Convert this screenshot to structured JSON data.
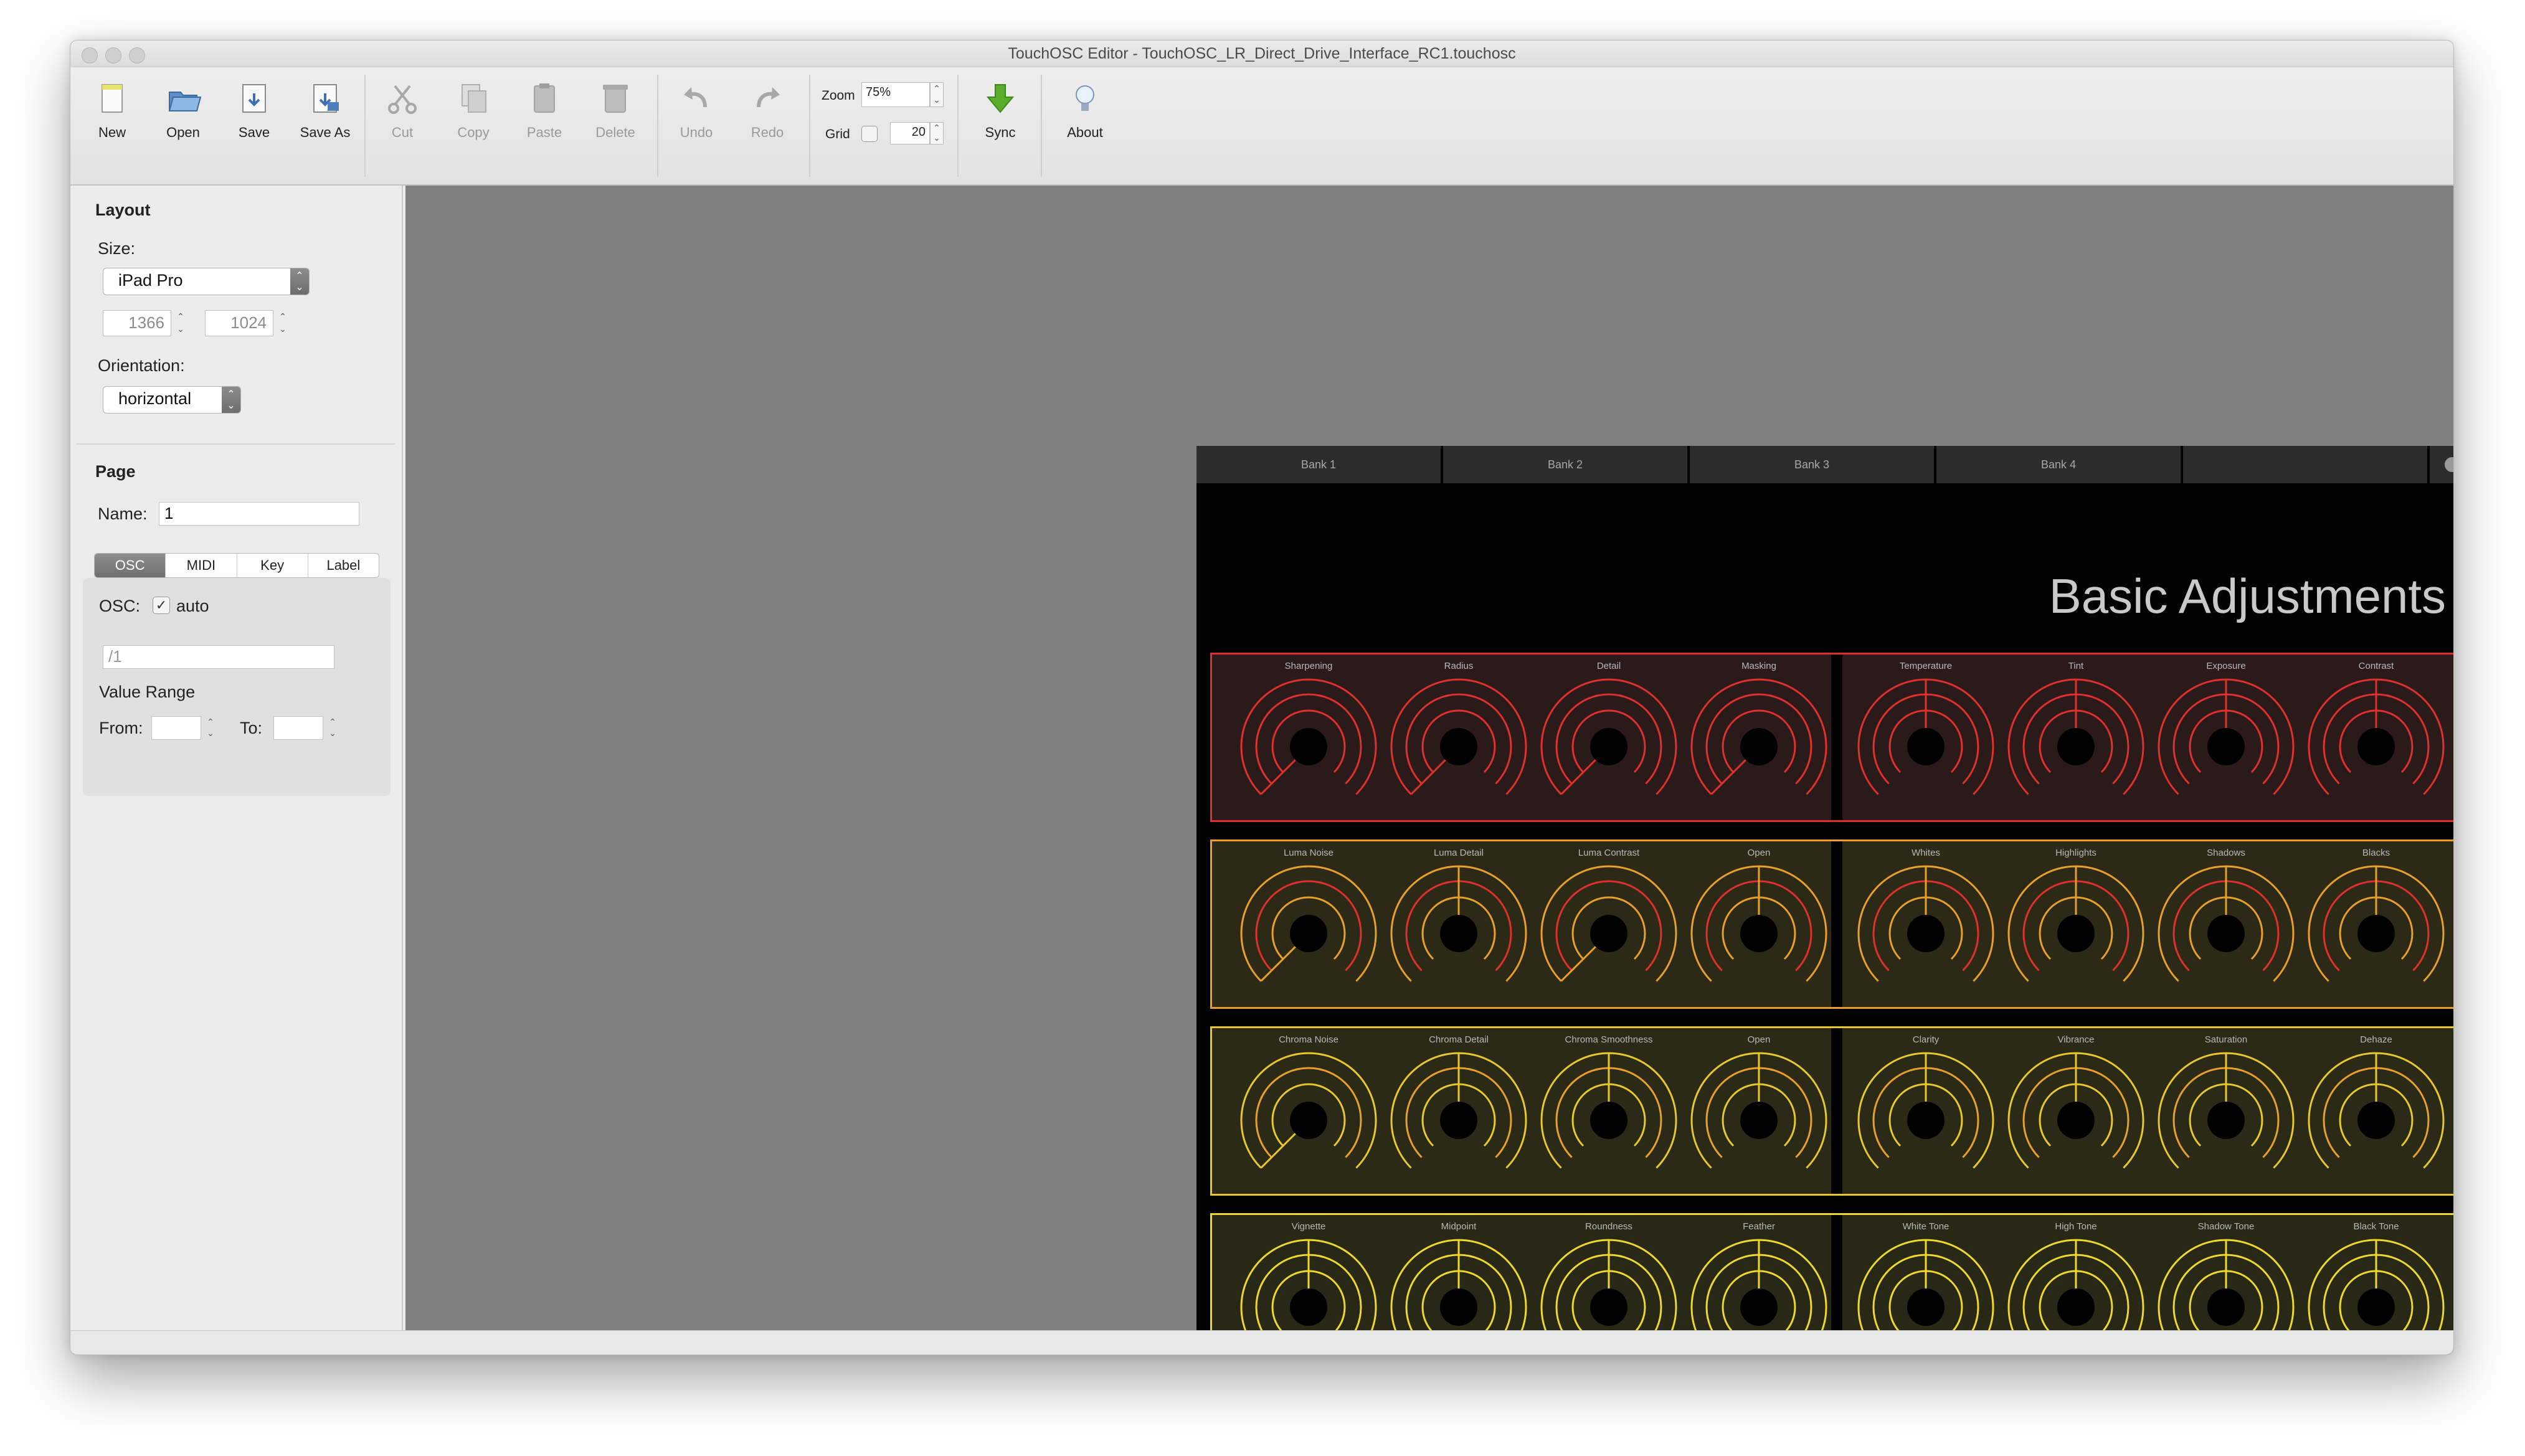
{
  "window": {
    "title": "TouchOSC Editor - TouchOSC_LR_Direct_Drive_Interface_RC1.touchosc"
  },
  "toolbar": {
    "new": "New",
    "open": "Open",
    "save": "Save",
    "save_as": "Save As",
    "cut": "Cut",
    "copy": "Copy",
    "paste": "Paste",
    "delete": "Delete",
    "undo": "Undo",
    "redo": "Redo",
    "zoom_label": "Zoom",
    "zoom_value": "75%",
    "grid_label": "Grid",
    "grid_value": "20",
    "sync": "Sync",
    "about": "About"
  },
  "sidebar": {
    "layout_title": "Layout",
    "size_label": "Size:",
    "size_value": "iPad Pro",
    "width_value": "1366",
    "height_value": "1024",
    "orientation_label": "Orientation:",
    "orientation_value": "horizontal",
    "page_title": "Page",
    "name_label": "Name:",
    "name_value": "1",
    "tabs": [
      "OSC",
      "MIDI",
      "Key",
      "Label"
    ],
    "osc_label": "OSC:",
    "auto_label": "auto",
    "osc_address": "/1",
    "value_range_label": "Value Range",
    "from_label": "From:",
    "to_label": "To:"
  },
  "device": {
    "banks": [
      "Bank 1",
      "Bank 2",
      "Bank 3",
      "Bank 4",
      ""
    ],
    "heading": "Basic Adjustments",
    "rows": [
      {
        "color": "#e0302c",
        "bg": "#2a1a1a",
        "outer_color": "#e0302c",
        "inner_color": "#e0302c",
        "labels": [
          "Sharpening",
          "Radius",
          "Detail",
          "Masking",
          "Temperature",
          "Tint",
          "Exposure",
          "Contrast"
        ],
        "values": [
          0,
          0,
          0,
          0,
          0.5,
          0.5,
          0.5,
          0.5
        ]
      },
      {
        "color": "#e8a02a",
        "bg": "#2c2a16",
        "outer_color": "#e8a02a",
        "inner_color": "#e0302c",
        "labels": [
          "Luma Noise",
          "Luma Detail",
          "Luma Contrast",
          "Open",
          "Whites",
          "Highlights",
          "Shadows",
          "Blacks"
        ],
        "values": [
          0,
          0.5,
          0,
          0.5,
          0.5,
          0.5,
          0.5,
          0.5
        ]
      },
      {
        "color": "#e8c82a",
        "bg": "#2a2a16",
        "outer_color": "#e8c82a",
        "inner_color": "#e8a02a",
        "labels": [
          "Chroma Noise",
          "Chroma Detail",
          "Chroma Smoothness",
          "Open",
          "Clarity",
          "Vibrance",
          "Saturation",
          "Dehaze"
        ],
        "values": [
          0,
          0.5,
          0.5,
          0.5,
          0.5,
          0.5,
          0.5,
          0.5
        ]
      },
      {
        "color": "#f0d82a",
        "bg": "#282816",
        "outer_color": "#f0d82a",
        "inner_color": "#f0d82a",
        "labels": [
          "Vignette",
          "Midpoint",
          "Roundness",
          "Feather",
          "White Tone",
          "High Tone",
          "Shadow Tone",
          "Black Tone"
        ],
        "values": [
          0.5,
          0.5,
          0.5,
          0.5,
          0.5,
          0.5,
          0.5,
          0.5
        ]
      }
    ]
  }
}
